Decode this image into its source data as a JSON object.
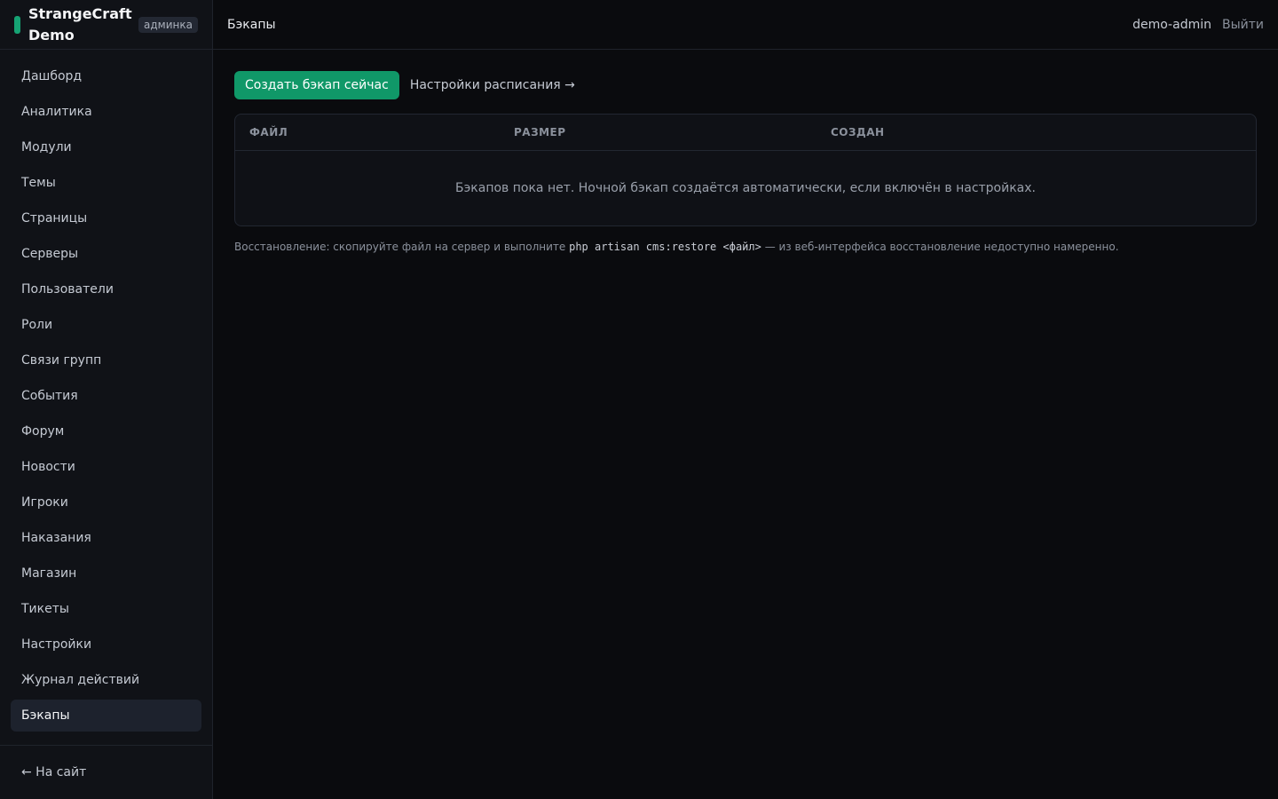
{
  "brand": {
    "name": "StrangeCraft Demo",
    "badge": "админка",
    "accent": "#16a374"
  },
  "sidebar": {
    "items": [
      {
        "label": "Дашборд",
        "name": "sidebar-item-dashboard"
      },
      {
        "label": "Аналитика",
        "name": "sidebar-item-analytics"
      },
      {
        "label": "Модули",
        "name": "sidebar-item-modules"
      },
      {
        "label": "Темы",
        "name": "sidebar-item-themes"
      },
      {
        "label": "Страницы",
        "name": "sidebar-item-pages"
      },
      {
        "label": "Серверы",
        "name": "sidebar-item-servers"
      },
      {
        "label": "Пользователи",
        "name": "sidebar-item-users"
      },
      {
        "label": "Роли",
        "name": "sidebar-item-roles"
      },
      {
        "label": "Связи групп",
        "name": "sidebar-item-group-links"
      },
      {
        "label": "События",
        "name": "sidebar-item-events"
      },
      {
        "label": "Форум",
        "name": "sidebar-item-forum"
      },
      {
        "label": "Новости",
        "name": "sidebar-item-news"
      },
      {
        "label": "Игроки",
        "name": "sidebar-item-players"
      },
      {
        "label": "Наказания",
        "name": "sidebar-item-punishments"
      },
      {
        "label": "Магазин",
        "name": "sidebar-item-shop"
      },
      {
        "label": "Тикеты",
        "name": "sidebar-item-tickets"
      },
      {
        "label": "Настройки",
        "name": "sidebar-item-settings"
      },
      {
        "label": "Журнал действий",
        "name": "sidebar-item-activity-log"
      },
      {
        "label": "Бэкапы",
        "name": "sidebar-item-backups",
        "active": true
      }
    ],
    "footer_link": "← На сайт"
  },
  "header": {
    "title": "Бэкапы",
    "user": "demo-admin",
    "logout": "Выйти"
  },
  "main": {
    "create_button": "Создать бэкап сейчас",
    "schedule_link": "Настройки расписания →",
    "table": {
      "columns": [
        "ФАЙЛ",
        "РАЗМЕР",
        "СОЗДАН"
      ],
      "empty_text": "Бэкапов пока нет. Ночной бэкап создаётся автоматически, если включён в настройках."
    },
    "note": {
      "prefix": "Восстановление: скопируйте файл на сервер и выполните",
      "command": "php artisan cms:restore <файл>",
      "suffix": "— из веб-интерфейса восстановление недоступно намеренно."
    }
  }
}
